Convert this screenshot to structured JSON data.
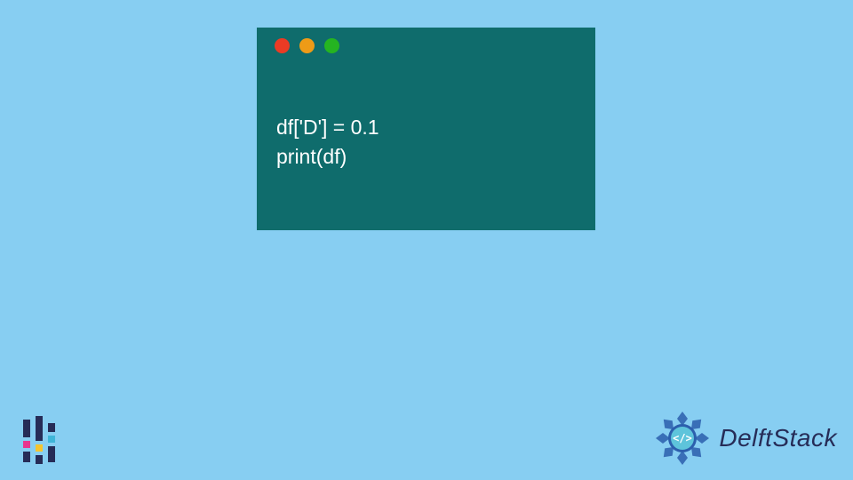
{
  "code": {
    "line1": "df['D'] = 0.1",
    "line2": "print(df)"
  },
  "brand": {
    "name": "DelftStack"
  },
  "colors": {
    "background": "#87cef2",
    "window": "#0f6c6c",
    "dot_red": "#ea3b24",
    "dot_yellow": "#ee9b17",
    "dot_green": "#25b421",
    "brand_text": "#262c57",
    "mandala": "#2c5fad"
  }
}
